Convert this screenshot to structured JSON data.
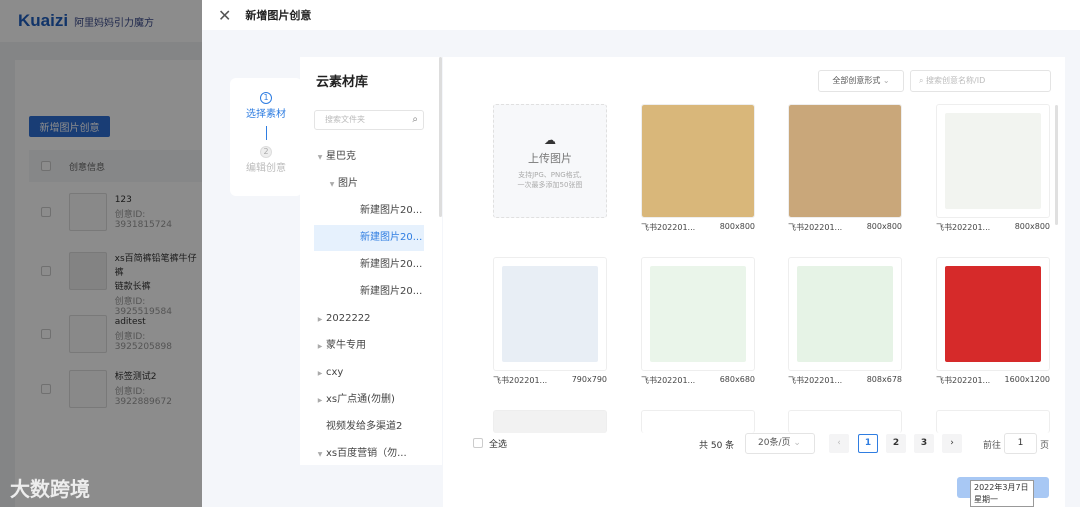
{
  "background": {
    "brand": "Kuaizi",
    "partner": "阿里妈妈引力魔方",
    "add_button": "新增图片创意",
    "column": "创意信息",
    "rows": [
      {
        "title": "123",
        "id": "创意ID: 3931815724"
      },
      {
        "title": "xs百简裤铅笔裤牛仔裤",
        "title2": "链款长裤",
        "id": "创意ID: 3925519584"
      },
      {
        "title": "aditest",
        "id": "创意ID: 3925205898"
      },
      {
        "title": "标签测试2",
        "id": "创意ID: 3922889672"
      }
    ],
    "watermark": "大数跨境"
  },
  "drawer": {
    "title": "新增图片创意",
    "steps": [
      {
        "num": "1",
        "label": "选择素材"
      },
      {
        "num": "2",
        "label": "编辑创意"
      }
    ],
    "folders": {
      "title": "云素材库",
      "search_placeholder": "搜索文件夹",
      "items": [
        {
          "label": "星巴克",
          "arrow": "▼"
        },
        {
          "label": "图片",
          "arrow": "▼"
        },
        {
          "label": "新建图片20..."
        },
        {
          "label": "新建图片20..."
        },
        {
          "label": "新建图片20..."
        },
        {
          "label": "新建图片20..."
        },
        {
          "label": "2022222",
          "arrow": "▶"
        },
        {
          "label": "蒙牛专用",
          "arrow": "▶"
        },
        {
          "label": "cxy",
          "arrow": "▶"
        },
        {
          "label": "xs广点通(勿删)",
          "arrow": "▶"
        },
        {
          "label": "视频发给多渠道2"
        },
        {
          "label": "xs百度营销（勿...",
          "arrow": "▼"
        }
      ]
    },
    "filter": "全部创意形式",
    "search_placeholder": "搜索创意名称/ID",
    "upload": {
      "title": "上传图片",
      "hint1": "支持JPG、PNG格式,",
      "hint2": "一次最多添加50张图"
    },
    "materials": [
      {
        "name": "飞书202201...",
        "size": "800x800",
        "color": "#d9b77a"
      },
      {
        "name": "飞书202201...",
        "size": "800x800",
        "color": "#c9a77a"
      },
      {
        "name": "飞书202201...",
        "size": "800x800",
        "color": "#f2f4f0"
      },
      {
        "name": "飞书202201...",
        "size": "790x790",
        "color": "#e8eef5"
      },
      {
        "name": "飞书202201...",
        "size": "680x680",
        "color": "#eaf5ea"
      },
      {
        "name": "飞书202201...",
        "size": "808x678",
        "color": "#e6f3e6"
      },
      {
        "name": "飞书202201...",
        "size": "1600x1200",
        "color": "#d62a2a"
      }
    ],
    "select_all": "全选",
    "total": "共 50 条",
    "page_size": "20条/页",
    "pages": [
      "1",
      "2",
      "3"
    ],
    "current_page": "1",
    "goto": "前往",
    "goto_value": "1",
    "page_unit": "页",
    "tooltip": {
      "date": "2022年3月7日",
      "weekday": "星期一"
    }
  }
}
